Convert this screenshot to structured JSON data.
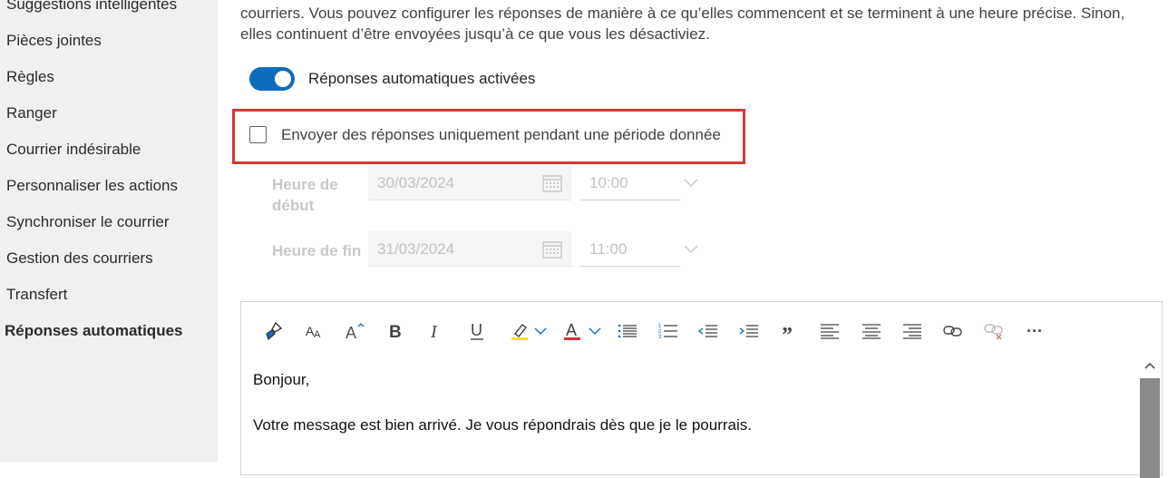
{
  "sidebar": {
    "items": [
      {
        "label": "Suggestions intelligentes"
      },
      {
        "label": "Pièces jointes"
      },
      {
        "label": "Règles"
      },
      {
        "label": "Ranger"
      },
      {
        "label": "Courrier indésirable"
      },
      {
        "label": "Personnaliser les actions"
      },
      {
        "label": "Synchroniser le courrier"
      },
      {
        "label": "Gestion des courriers"
      },
      {
        "label": "Transfert"
      },
      {
        "label": "Réponses automatiques"
      }
    ],
    "active": "Réponses automatiques"
  },
  "description": {
    "line1": "courriers. Vous pouvez configurer les réponses de manière à ce qu’elles commencent et se terminent à une heure précise. Sinon,",
    "line2": "elles continuent d’être envoyées jusqu’à ce que vous les désactiviez."
  },
  "toggle": {
    "label": "Réponses automatiques activées",
    "on": true
  },
  "checkbox": {
    "label": "Envoyer des réponses uniquement pendant une période donnée",
    "checked": false
  },
  "start": {
    "label_line1": "Heure de",
    "label_line2": "début",
    "date": "30/03/2024",
    "time": "10:00"
  },
  "end": {
    "label": "Heure de fin",
    "date": "31/03/2024",
    "time": "11:00"
  },
  "editor": {
    "line1": "Bonjour,",
    "line2": "Votre message est bien arrivé. Je vous répondrais dès que je le pourrais.",
    "more_label": "···"
  },
  "colors": {
    "accent": "#0f6cbd",
    "highlight_border": "#d93636",
    "highlight_yellow": "#f5e400",
    "font_red": "#d13438"
  }
}
